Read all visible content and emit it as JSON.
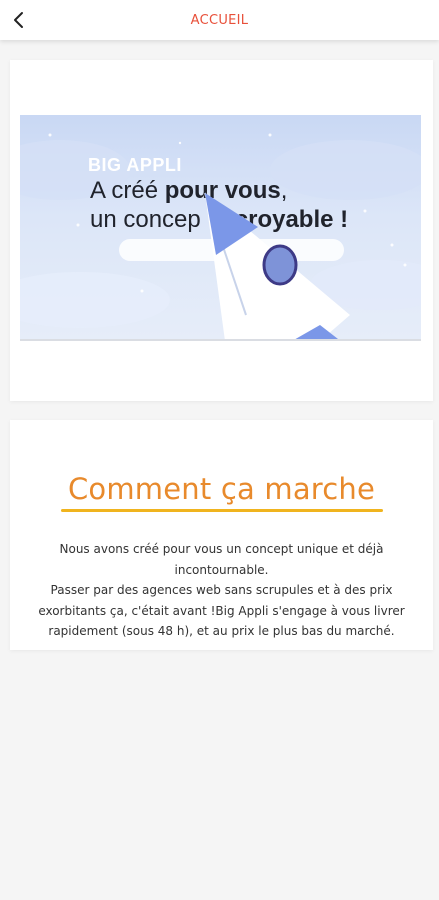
{
  "header": {
    "title": "ACCUEIL",
    "back_icon": "chevron-left-icon"
  },
  "banner": {
    "brand": "BIG APPLI",
    "line1_regular": "A créé ",
    "line1_bold": "pour vous",
    "line1_end": ",",
    "line2_regular": "un concep",
    "line2_bold": "croyable !",
    "graphic": "rocket-illustration"
  },
  "section": {
    "title": "Comment ça marche",
    "description_lines": [
      "Nous avons créé pour vous un concept unique et déjà",
      "incontournable.",
      "Passer par des agences web sans scrupules et à des prix",
      "exorbitants ça, c'était avant !Big Appli s'engage à vous livrer",
      "rapidement (sous 48 h), et au prix le plus bas du marché."
    ]
  },
  "colors": {
    "accent_red": "#e8503a",
    "title_orange": "#e88a2c",
    "underline_yellow": "#f0b41e",
    "banner_bg": "#dce6f8",
    "rocket_blue": "#7b97e8"
  }
}
